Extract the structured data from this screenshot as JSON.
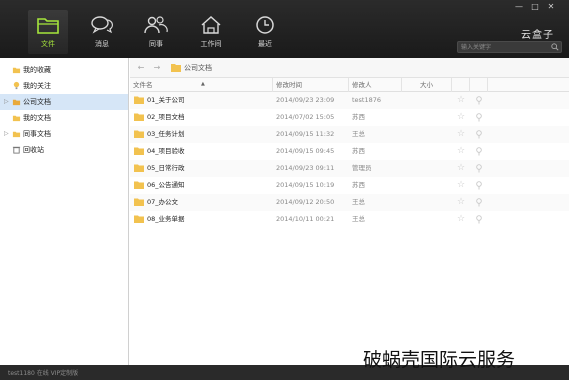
{
  "app": {
    "brand": "云盒子",
    "search_placeholder": "输入关键字"
  },
  "nav": [
    {
      "label": "文件",
      "icon": "folder-icon",
      "active": true
    },
    {
      "label": "消息",
      "icon": "chat-bubbles-icon",
      "active": false
    },
    {
      "label": "同事",
      "icon": "people-icon",
      "active": false
    },
    {
      "label": "工作间",
      "icon": "house-icon",
      "active": false
    },
    {
      "label": "最近",
      "icon": "clock-icon",
      "active": false
    }
  ],
  "window_controls": [
    "minimize-icon",
    "maximize-icon",
    "close-icon"
  ],
  "sidebar": {
    "items": [
      {
        "label": "我的收藏",
        "icon": "star-folder-icon"
      },
      {
        "label": "我的关注",
        "icon": "bulb-icon"
      },
      {
        "label": "公司文档",
        "icon": "company-folder-icon",
        "active": true
      },
      {
        "label": "我的文档",
        "icon": "my-folder-icon"
      },
      {
        "label": "同事文档",
        "icon": "shared-folder-icon"
      },
      {
        "label": "回收站",
        "icon": "trash-icon"
      }
    ]
  },
  "pathbar": {
    "crumb": "公司文档"
  },
  "table": {
    "columns": [
      "文件名",
      "修改时间",
      "修改人",
      "大小"
    ],
    "rows": [
      {
        "name": "01_关于公司",
        "modified": "2014/09/23 23:09",
        "user": "test1876"
      },
      {
        "name": "02_项目文档",
        "modified": "2014/07/02 15:05",
        "user": "苏西"
      },
      {
        "name": "03_任务计划",
        "modified": "2014/09/15 11:32",
        "user": "王总"
      },
      {
        "name": "04_项目验收",
        "modified": "2014/09/15 09:45",
        "user": "苏西"
      },
      {
        "name": "05_日常行政",
        "modified": "2014/09/23 09:11",
        "user": "管理员"
      },
      {
        "name": "06_公告通知",
        "modified": "2014/09/15 10:19",
        "user": "苏西"
      },
      {
        "name": "07_办公文",
        "modified": "2014/09/12 20:50",
        "user": "王总"
      },
      {
        "name": "08_业务单据",
        "modified": "2014/10/11 00:21",
        "user": "王总"
      }
    ]
  },
  "status": {
    "text": "test1180 在线 VIP定制版"
  },
  "watermark": "破蜗壳国际云服务",
  "colors": {
    "topbar": "#1f1f1f",
    "active_nav": "#a6e63c",
    "folder": "#f2c24f",
    "selected_sidebar": "#d6e6f7"
  }
}
